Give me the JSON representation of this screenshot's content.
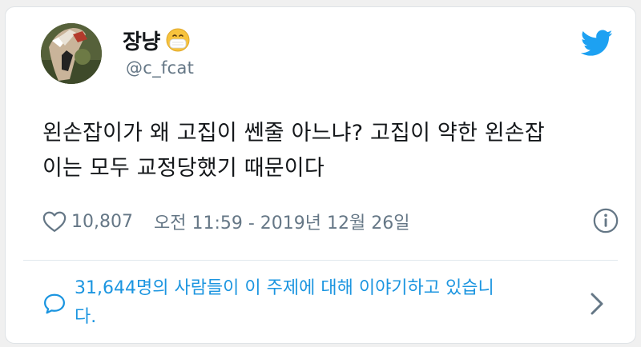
{
  "author": {
    "display_name": "장냥",
    "handle": "@c_fcat",
    "name_emoji": "face-with-medical-mask-icon"
  },
  "tweet": {
    "text_lines": [
      "왼손잡이가 왜 고집이 쎈줄 아느냐? 고집이 약한 왼손잡",
      "이는 모두 교정당했기 때문이다"
    ]
  },
  "meta": {
    "like_count": "10,807",
    "timestamp": "오전 11:59 - 2019년 12월 26일"
  },
  "conversation": {
    "text_lines": [
      "31,644명의 사람들이 이 주제에 대해 이야기하고 있습니",
      "다."
    ]
  },
  "colors": {
    "twitter_blue": "#1da1f2",
    "link_blue": "#1b95e0",
    "secondary_text": "#657786",
    "primary_text": "#14171a"
  },
  "icons": {
    "brand": "twitter-bird-icon",
    "like": "heart-outline-icon",
    "info": "info-circle-icon",
    "conversation": "speech-bubble-icon",
    "chevron": "chevron-right-icon"
  }
}
